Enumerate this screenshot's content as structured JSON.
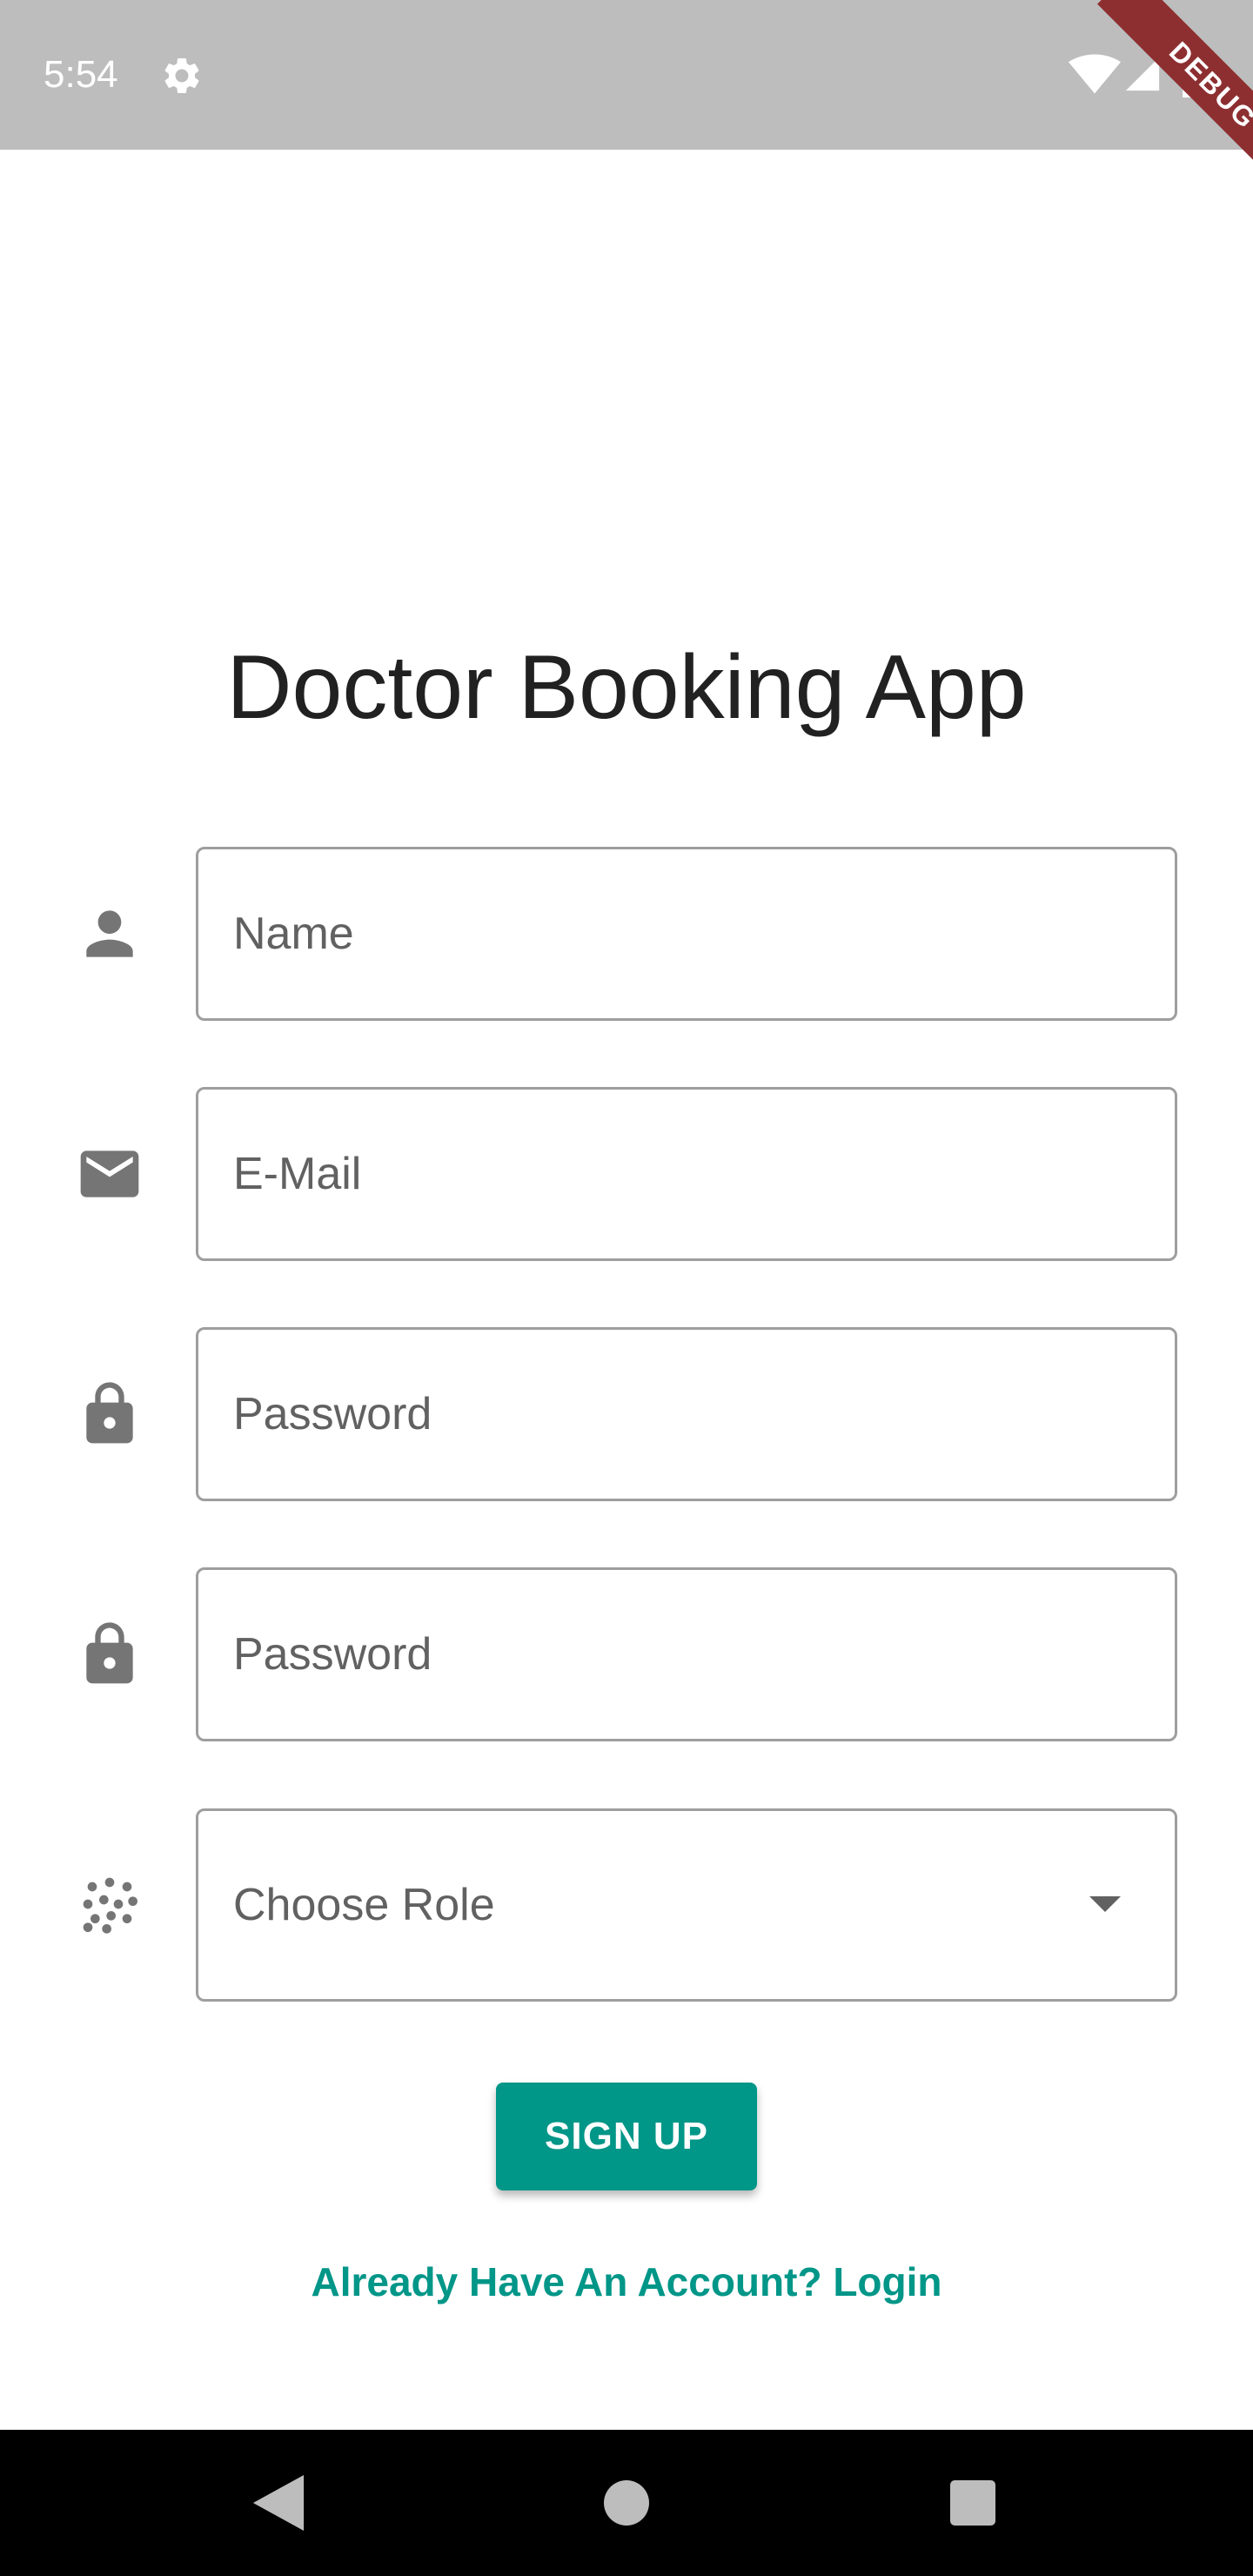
{
  "status_bar": {
    "time": "5:54",
    "icons": [
      "settings-icon",
      "wifi-icon",
      "signal-icon",
      "battery-icon"
    ]
  },
  "debug_banner": "DEBUG",
  "app_title": "Doctor Booking App",
  "form": {
    "name": {
      "placeholder": "Name",
      "icon": "person-icon",
      "value": ""
    },
    "email": {
      "placeholder": "E-Mail",
      "icon": "mail-icon",
      "value": ""
    },
    "password": {
      "placeholder": "Password",
      "icon": "lock-icon",
      "value": ""
    },
    "confirm_password": {
      "placeholder": "Password",
      "icon": "lock-icon",
      "value": ""
    },
    "role": {
      "placeholder": "Choose Role",
      "icon": "dots-grid-icon",
      "value": ""
    }
  },
  "signup_button": "SIGN UP",
  "login_link": "Already Have An Account? Login",
  "colors": {
    "accent": "#009688",
    "status_bar": "#bdbdbd",
    "debug_banner": "#8d2f31",
    "icon_gray": "#757575",
    "nav_bar": "#000000"
  },
  "nav_bar": {
    "icons": [
      "back-icon",
      "home-icon",
      "recents-icon"
    ]
  }
}
